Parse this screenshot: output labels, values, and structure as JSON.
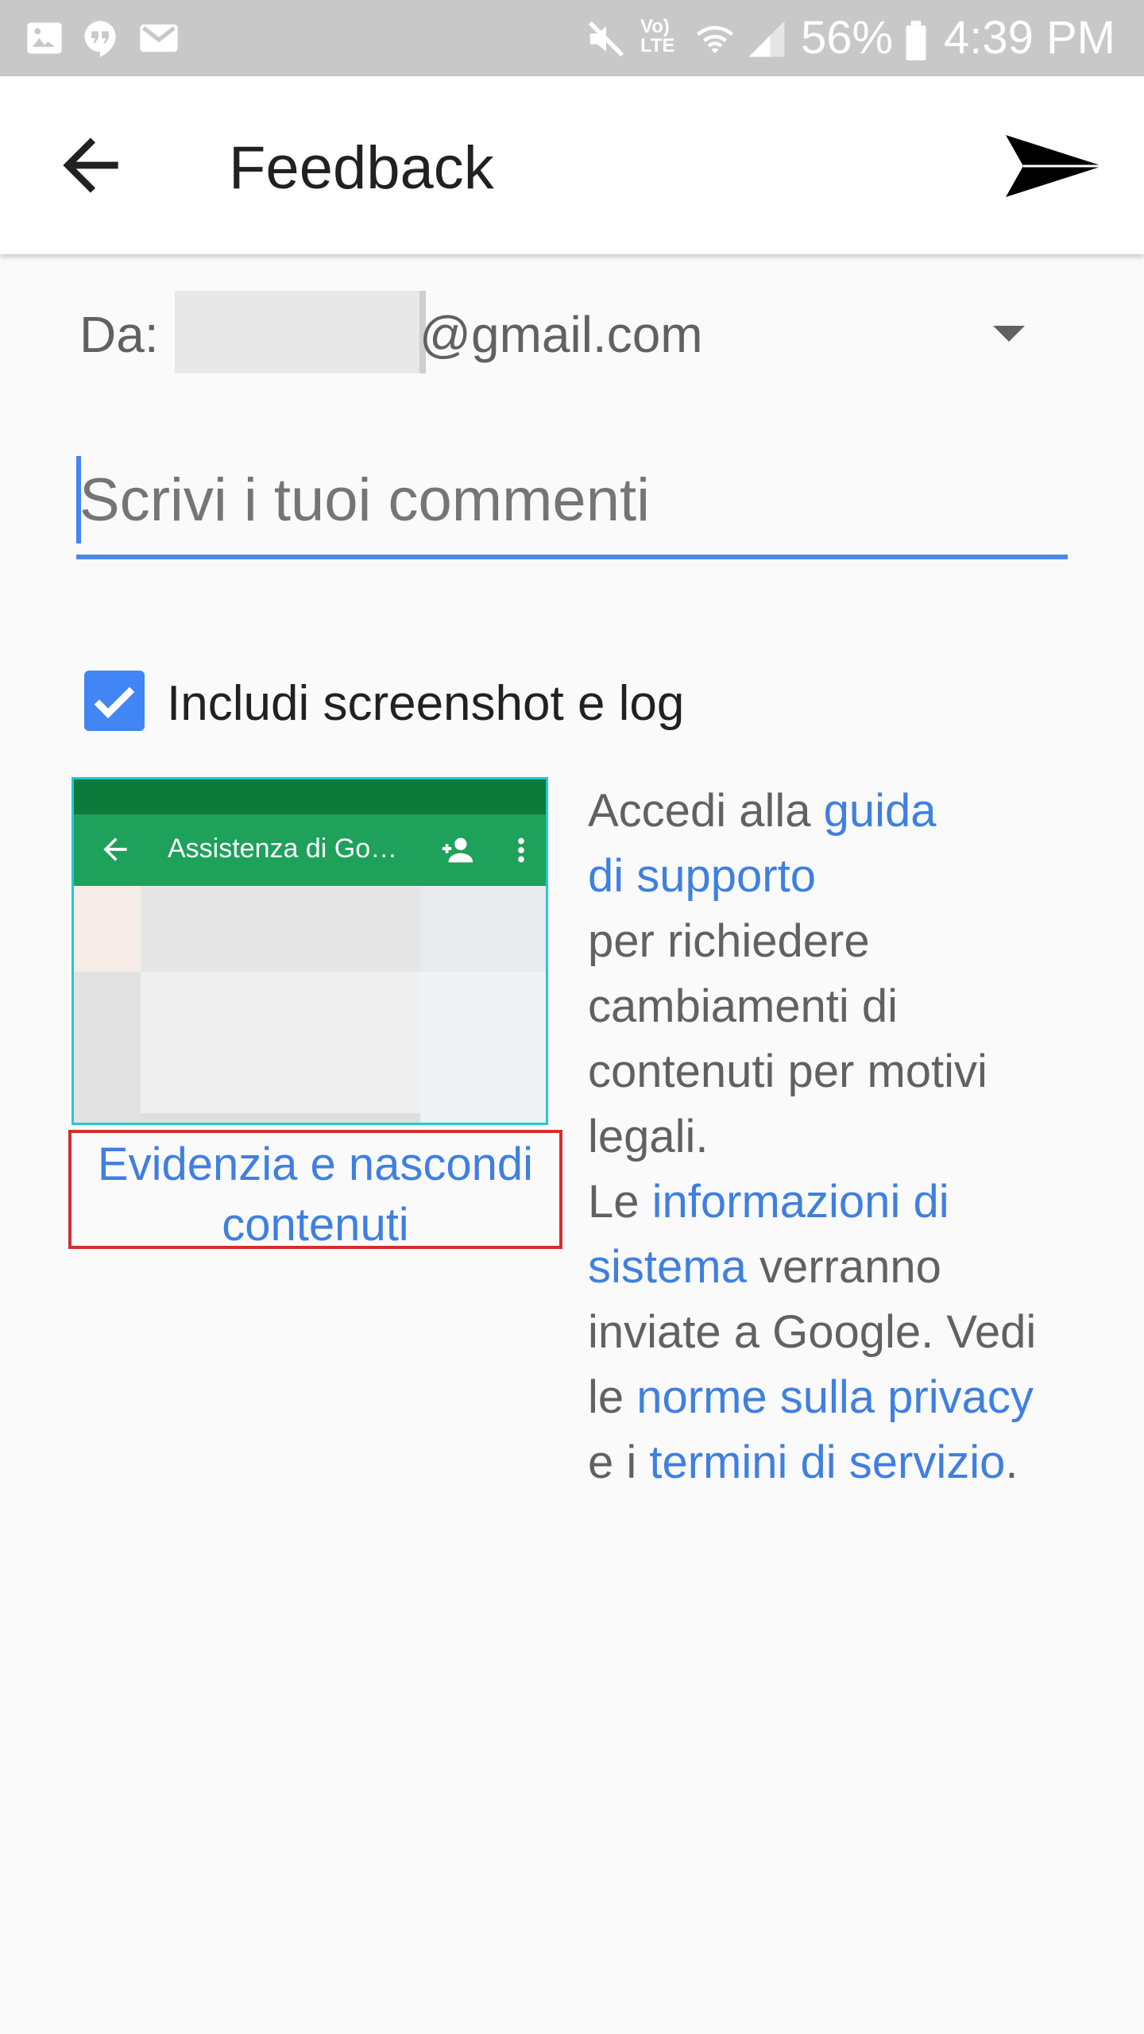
{
  "status_bar": {
    "battery": "56%",
    "time": "4:39 PM",
    "network_label": "Vo) LTE"
  },
  "app_bar": {
    "title": "Feedback",
    "back_icon": "arrow-back-icon",
    "send_icon": "send-icon"
  },
  "from": {
    "label": "Da:",
    "email_suffix": "@gmail.com"
  },
  "comment": {
    "placeholder": "Scrivi i tuoi commenti"
  },
  "include": {
    "label": "Includi screenshot e log",
    "checked": true
  },
  "preview": {
    "title": "Assistenza di Go…",
    "link_line1": "Evidenzia e nascondi",
    "link_line2": "contenuti"
  },
  "info": {
    "t1": "Accedi alla ",
    "l1a": "guida",
    "l1b": "di supporto",
    "t2": "per richiedere",
    "t3": "cambiamenti di",
    "t4": "contenuti per motivi",
    "t5": "legali.",
    "t6": "Le ",
    "l2a": "informazioni di",
    "l2b": "sistema",
    "t7": " verranno",
    "t8": "inviate a Google. Vedi",
    "t9": "le ",
    "l3": "norme sulla privacy",
    "t10": "e i ",
    "l4": "termini di servizio",
    "t11": "."
  },
  "colors": {
    "accent": "#4285f4",
    "link": "#3f7fe0",
    "highlight_border": "#d32f2f",
    "preview_green": "#1da15b"
  }
}
